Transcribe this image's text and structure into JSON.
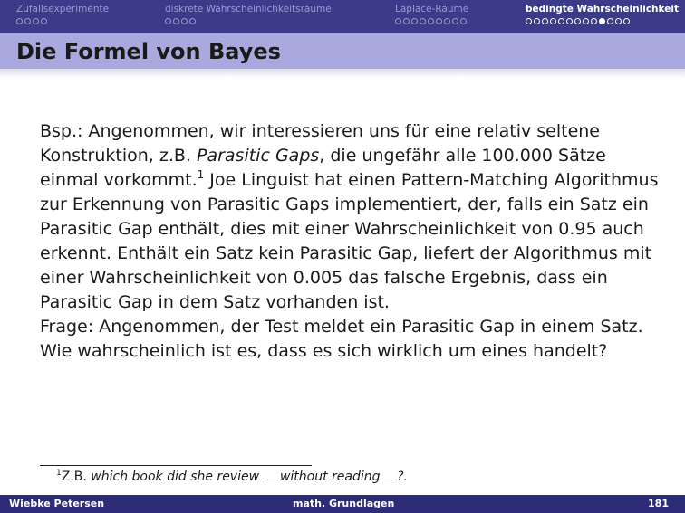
{
  "nav": {
    "sections": [
      {
        "title": "Zufallsexperimente",
        "dots": 4,
        "filled": -1,
        "active": false
      },
      {
        "title": "diskrete Wahrscheinlichkeitsräume",
        "dots": 4,
        "filled": -1,
        "active": false
      },
      {
        "title": "Laplace-Räume",
        "dots": 9,
        "filled": -1,
        "active": false
      },
      {
        "title": "bedingte Wahrscheinlichkeit",
        "dots": 13,
        "filled": 9,
        "active": true
      }
    ]
  },
  "frame": {
    "title": "Die Formel von Bayes"
  },
  "body": {
    "p1_part1": "Bsp.: Angenommen, wir interessieren uns für eine relativ seltene Konstruktion, z.B. ",
    "p1_emph": "Parasitic Gaps",
    "p1_part2": ", die ungefähr alle 100.000 Sätze einmal vorkommt.",
    "p1_fnmark": "1",
    "p1_part3": " Joe Linguist hat einen Pattern-Matching Algorithmus zur Erkennung von Parasitic Gaps implementiert, der, falls ein Satz ein Parasitic Gap enthält, dies mit einer Wahrscheinlichkeit von 0.95 auch erkennt. Enthält ein Satz kein Parasitic Gap, liefert der Algorithmus mit einer Wahrscheinlichkeit von 0.005 das falsche Ergebnis, dass ein Parasitic Gap in dem Satz vorhanden ist.",
    "p2": "Frage: Angenommen, der Test meldet ein Parasitic Gap in einem Satz. Wie wahrscheinlich ist es, dass es sich wirklich um eines handelt?"
  },
  "footnote": {
    "mark": "1",
    "prefix": "Z.B. ",
    "emph1": "which book did she review",
    "emph2": "without reading",
    "suffix": "?."
  },
  "footer": {
    "author": "Wiebke Petersen",
    "title": "math. Grundlagen",
    "page": "181"
  }
}
